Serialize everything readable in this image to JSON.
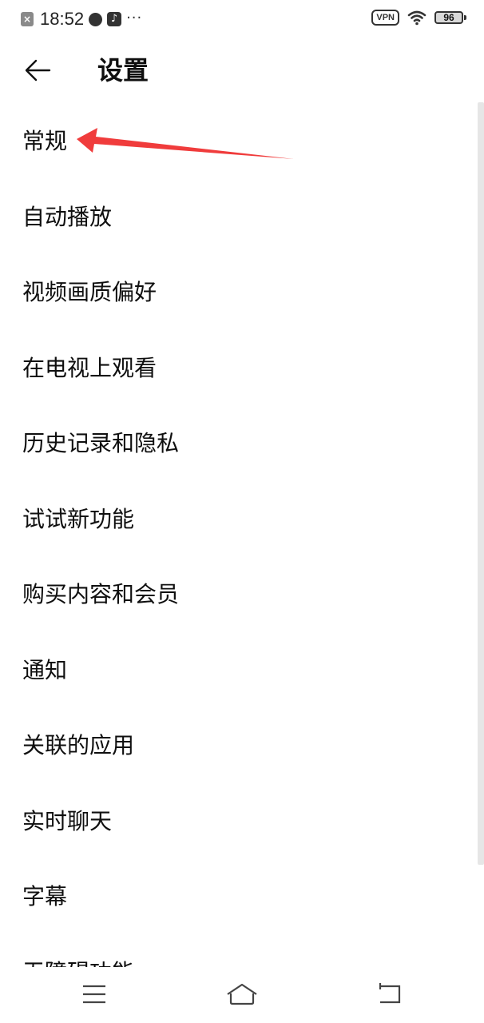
{
  "status_bar": {
    "time": "18:52",
    "dots": "···",
    "vpn_label": "VPN",
    "battery_level": "96",
    "icons": [
      "close-box-icon",
      "planet-icon",
      "tiktok-icon",
      "wifi-icon",
      "battery-icon"
    ]
  },
  "header": {
    "back_icon": "arrow-left-icon",
    "title": "设置"
  },
  "settings": {
    "items": [
      {
        "label": "常规"
      },
      {
        "label": "自动播放"
      },
      {
        "label": "视频画质偏好"
      },
      {
        "label": "在电视上观看"
      },
      {
        "label": "历史记录和隐私"
      },
      {
        "label": "试试新功能"
      },
      {
        "label": "购买内容和会员"
      },
      {
        "label": "通知"
      },
      {
        "label": "关联的应用"
      },
      {
        "label": "实时聊天"
      },
      {
        "label": "字幕"
      },
      {
        "label": "无障碍功能"
      }
    ]
  },
  "annotation": {
    "type": "red-arrow",
    "color": "#f03c3c",
    "points_to": "常规"
  },
  "nav_bar": {
    "icons": [
      "menu-icon",
      "home-icon",
      "back-icon"
    ]
  }
}
